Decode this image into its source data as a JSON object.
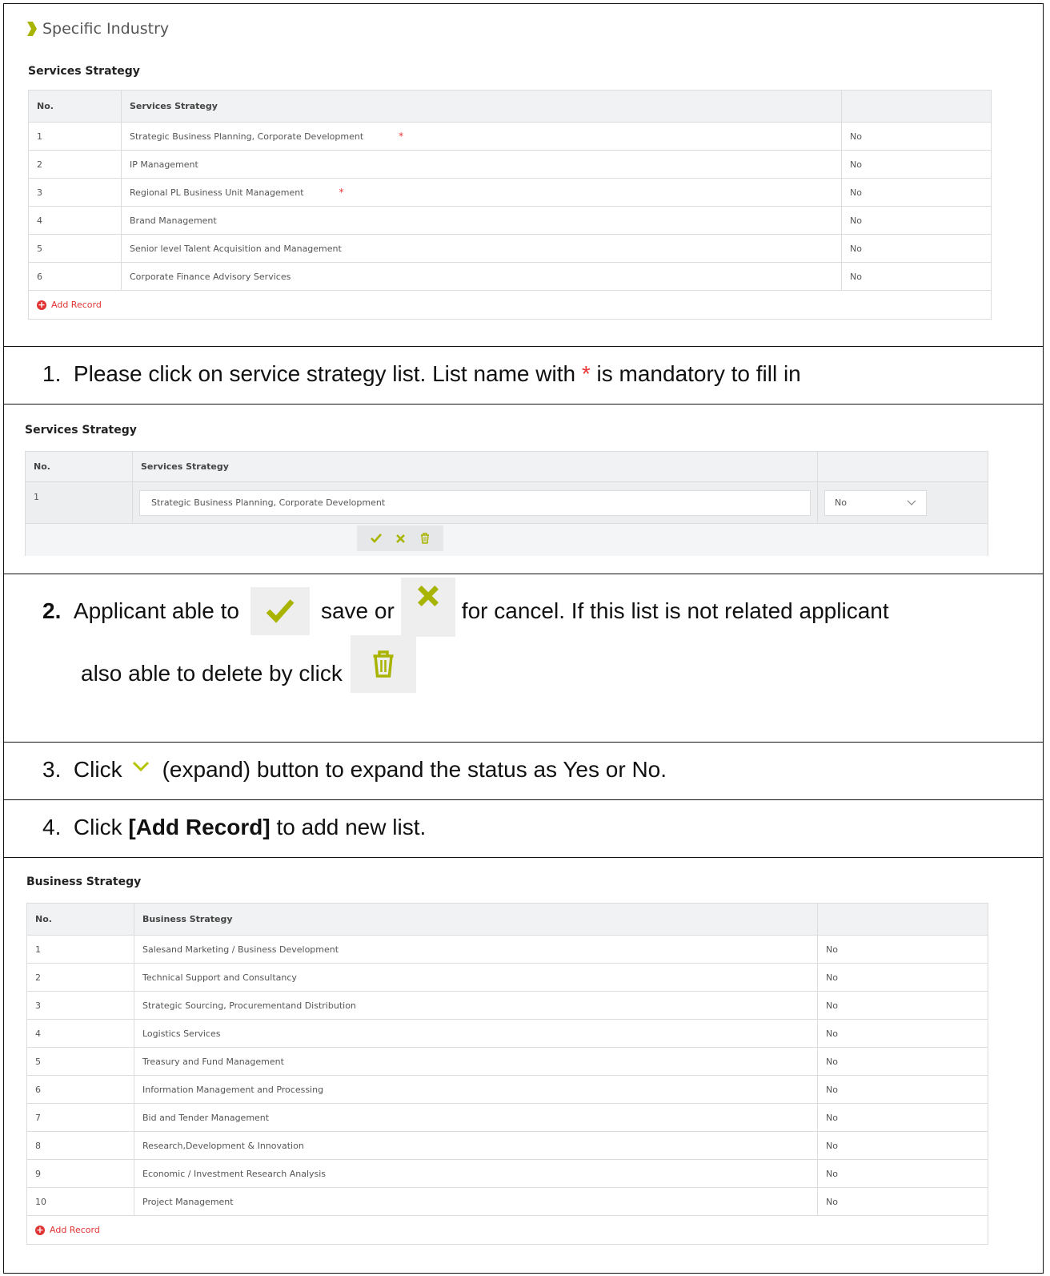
{
  "section1": {
    "title": "Specific Industry",
    "label": "Services Strategy",
    "columns": [
      "No.",
      "Services Strategy",
      ""
    ],
    "rows": [
      {
        "no": "1",
        "name": "Strategic Business Planning, Corporate Development",
        "required": "*",
        "value": "No"
      },
      {
        "no": "2",
        "name": "IP Management",
        "required": "",
        "value": "No"
      },
      {
        "no": "3",
        "name": "Regional PL Business Unit Management",
        "required": "*",
        "value": "No"
      },
      {
        "no": "4",
        "name": "Brand Management",
        "required": "",
        "value": "No"
      },
      {
        "no": "5",
        "name": "Senior level Talent Acquisition and Management",
        "required": "",
        "value": "No"
      },
      {
        "no": "6",
        "name": "Corporate Finance Advisory Services",
        "required": "",
        "value": "No"
      }
    ],
    "add_record": "Add Record"
  },
  "instruction1": {
    "num": "1.",
    "text_a": "Please click on service strategy list. List name with",
    "star": "*",
    "text_b": "is mandatory to fill in"
  },
  "edit_section": {
    "label": "Services Strategy",
    "columns": [
      "No.",
      "Services Strategy",
      ""
    ],
    "row_no": "1",
    "input_value": "Strategic Business Planning, Corporate Development",
    "select_value": "No"
  },
  "instruction2": {
    "num": "2.",
    "text_a": "Applicant able to",
    "text_b": "save or",
    "text_c": "for cancel. If this list is not related applicant",
    "text_d": "also able to delete by click"
  },
  "instruction3": {
    "num": "3.",
    "text_a": "Click",
    "text_b": "(expand) button to expand the status as Yes or No."
  },
  "instruction4": {
    "num": "4.",
    "text_a": "Click",
    "bold": "[Add Record]",
    "text_b": "to add new list."
  },
  "section2": {
    "label": "Business Strategy",
    "columns": [
      "No.",
      "Business Strategy",
      ""
    ],
    "rows": [
      {
        "no": "1",
        "name": "Salesand Marketing / Business Development",
        "value": "No"
      },
      {
        "no": "2",
        "name": "Technical Support and Consultancy",
        "value": "No"
      },
      {
        "no": "3",
        "name": "Strategic Sourcing, Procurementand Distribution",
        "value": "No"
      },
      {
        "no": "4",
        "name": "Logistics Services",
        "value": "No"
      },
      {
        "no": "5",
        "name": "Treasury and Fund Management",
        "value": "No"
      },
      {
        "no": "6",
        "name": "Information Management and Processing",
        "value": "No"
      },
      {
        "no": "7",
        "name": "Bid and Tender Management",
        "value": "No"
      },
      {
        "no": "8",
        "name": "Research,Development & Innovation",
        "value": "No"
      },
      {
        "no": "9",
        "name": "Economic / Investment Research Analysis",
        "value": "No"
      },
      {
        "no": "10",
        "name": "Project Management",
        "value": "No"
      }
    ],
    "add_record": "Add Record"
  },
  "colors": {
    "accent_green": "#a8b400",
    "required_red": "#e33333",
    "add_red": "#e03434"
  }
}
